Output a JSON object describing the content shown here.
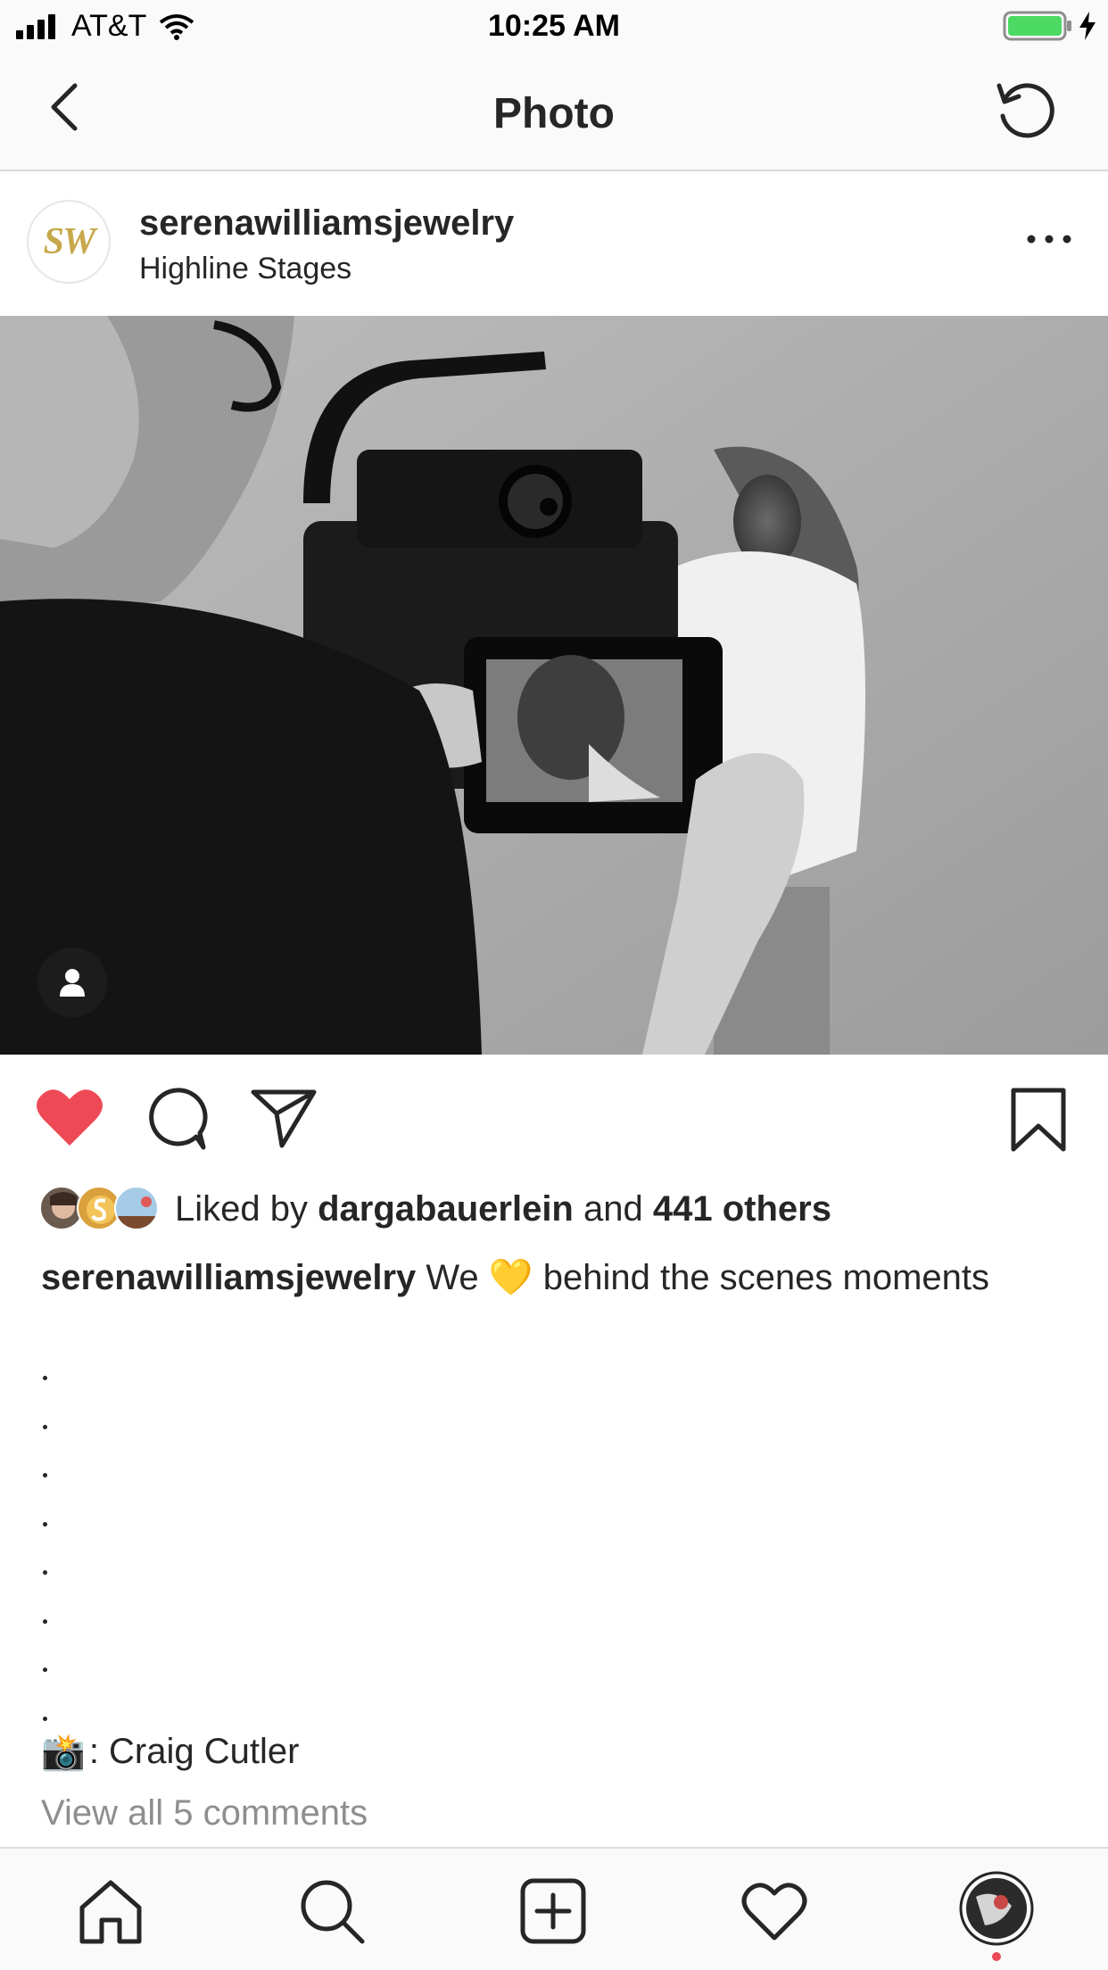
{
  "status_bar": {
    "carrier": "AT&T",
    "time": "10:25 AM",
    "battery_color": "#4cd964"
  },
  "nav": {
    "title": "Photo",
    "back_icon": "chevron-left-icon",
    "refresh_icon": "refresh-icon"
  },
  "post": {
    "username": "serenawilliamsjewelry",
    "location": "Highline Stages",
    "avatar_text": "SW",
    "liked": true,
    "like_color": "#ed4956",
    "likes": {
      "prefix": "Liked by",
      "user": "dargabauerlein",
      "middle": "and",
      "others": "441 others"
    },
    "caption": {
      "username": "serenawilliamsjewelry",
      "text_before": "We",
      "emoji": "💛",
      "text_after": "behind the scenes moments"
    },
    "credit": {
      "emoji": "📸",
      "text": ": Craig Cutler"
    },
    "view_comments": "View all 5 comments"
  },
  "tabbar": {
    "items": [
      "home-icon",
      "search-icon",
      "new-post-icon",
      "activity-heart-icon",
      "profile-avatar"
    ]
  }
}
